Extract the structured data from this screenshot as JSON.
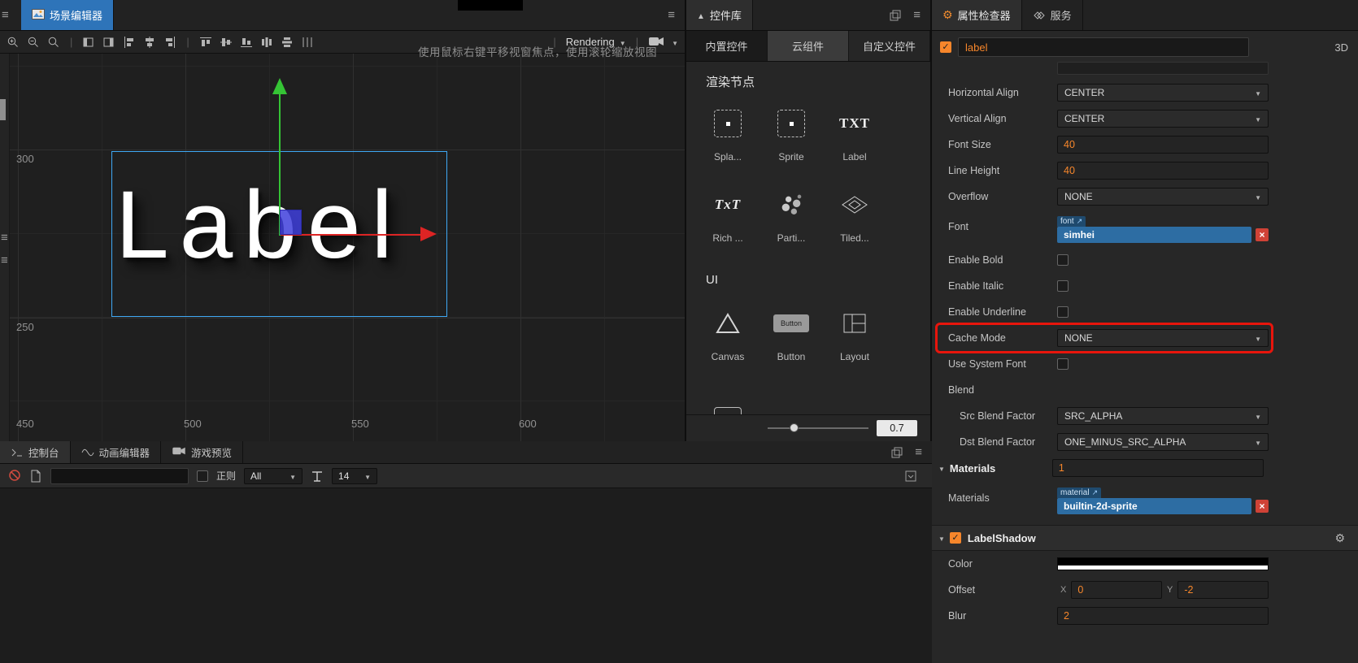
{
  "colors": {
    "accent": "#f6862b",
    "annotation_red": "#e8150c",
    "asset_blue": "#2d6da3",
    "scene_tab_blue": "#2e74b9"
  },
  "scene": {
    "tab": "场景编辑器",
    "rendering": "Rendering",
    "hint": "使用鼠标右键平移视窗焦点，使用滚轮缩放视图",
    "label_text": "Label",
    "ruler_left": [
      "300",
      "250"
    ],
    "ruler_bottom": [
      "450",
      "500",
      "550",
      "600"
    ]
  },
  "widgets": {
    "tab": "控件库",
    "tabs": [
      "内置控件",
      "云组件",
      "自定义控件"
    ],
    "section_render": "渲染节点",
    "section_ui": "UI",
    "render_items": [
      "Spla...",
      "Sprite",
      "Label",
      "Rich ...",
      "Parti...",
      "Tiled..."
    ],
    "ui_items": [
      "Canvas",
      "Button",
      "Layout"
    ],
    "label_icon": "TXT",
    "rich_icon": "TxT",
    "button_icon": "Button",
    "zoom": "0.7"
  },
  "inspector": {
    "tab_inspector": "属性检查器",
    "tab_services": "服务",
    "node_name": "label",
    "badge": "3D",
    "horizontal_align": {
      "label": "Horizontal Align",
      "value": "CENTER"
    },
    "vertical_align": {
      "label": "Vertical Align",
      "value": "CENTER"
    },
    "font_size": {
      "label": "Font Size",
      "value": "40"
    },
    "line_height": {
      "label": "Line Height",
      "value": "40"
    },
    "overflow": {
      "label": "Overflow",
      "value": "NONE"
    },
    "font": {
      "label": "Font",
      "chip": "font",
      "value": "simhei"
    },
    "enable_bold": {
      "label": "Enable Bold"
    },
    "enable_italic": {
      "label": "Enable Italic"
    },
    "enable_underline": {
      "label": "Enable Underline"
    },
    "cache_mode": {
      "label": "Cache Mode",
      "value": "NONE"
    },
    "use_system_font": {
      "label": "Use System Font"
    },
    "blend": {
      "label": "Blend"
    },
    "src_blend": {
      "label": "Src Blend Factor",
      "value": "SRC_ALPHA"
    },
    "dst_blend": {
      "label": "Dst Blend Factor",
      "value": "ONE_MINUS_SRC_ALPHA"
    },
    "materials_section": {
      "label": "Materials",
      "value": "1"
    },
    "materials": {
      "label": "Materials",
      "chip": "material",
      "value": "builtin-2d-sprite"
    },
    "label_shadow": {
      "label": "LabelShadow"
    },
    "color": {
      "label": "Color"
    },
    "offset": {
      "label": "Offset",
      "x_label": "X",
      "x": "0",
      "y_label": "Y",
      "y": "-2"
    },
    "blur": {
      "label": "Blur",
      "value": "2"
    }
  },
  "console": {
    "tabs": [
      "控制台",
      "动画编辑器",
      "游戏预览"
    ],
    "regex": "正则",
    "filter": "All",
    "font_size": "14"
  }
}
